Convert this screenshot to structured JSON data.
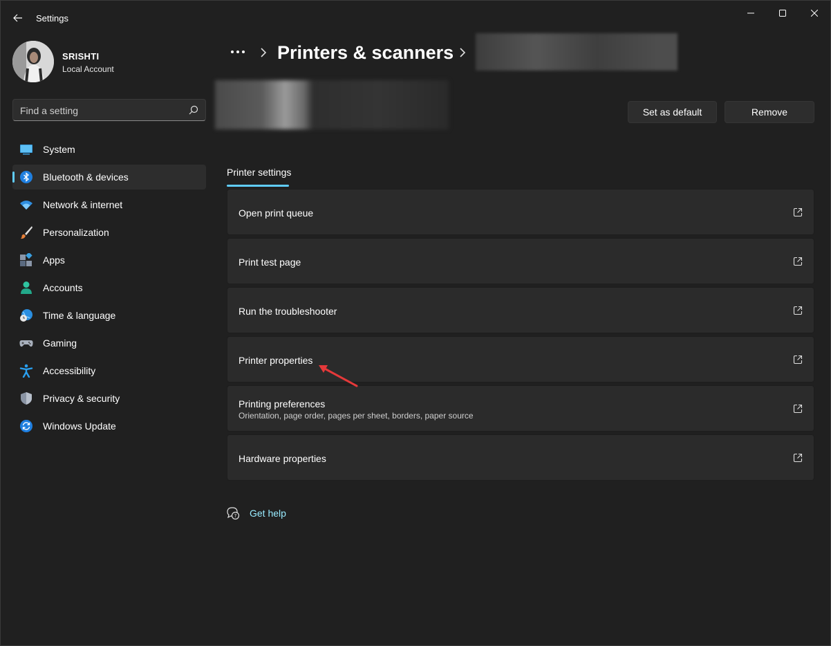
{
  "window": {
    "title": "Settings"
  },
  "profile": {
    "name": "SRISHTI",
    "account_type": "Local Account"
  },
  "search": {
    "placeholder": "Find a setting"
  },
  "nav": {
    "items": [
      {
        "label": "System",
        "icon": "monitor-icon"
      },
      {
        "label": "Bluetooth & devices",
        "icon": "bluetooth-icon",
        "selected": true
      },
      {
        "label": "Network & internet",
        "icon": "wifi-icon"
      },
      {
        "label": "Personalization",
        "icon": "brush-icon"
      },
      {
        "label": "Apps",
        "icon": "apps-icon"
      },
      {
        "label": "Accounts",
        "icon": "person-icon"
      },
      {
        "label": "Time & language",
        "icon": "globe-clock-icon"
      },
      {
        "label": "Gaming",
        "icon": "gamepad-icon"
      },
      {
        "label": "Accessibility",
        "icon": "accessibility-icon"
      },
      {
        "label": "Privacy & security",
        "icon": "shield-icon"
      },
      {
        "label": "Windows Update",
        "icon": "update-icon"
      }
    ]
  },
  "breadcrumb": {
    "more": "...",
    "title": "Printers & scanners"
  },
  "printer": {
    "set_default_label": "Set as default",
    "remove_label": "Remove"
  },
  "tabs": {
    "active": "Printer settings"
  },
  "cards": [
    {
      "title": "Open print queue"
    },
    {
      "title": "Print test page"
    },
    {
      "title": "Run the troubleshooter"
    },
    {
      "title": "Printer properties"
    },
    {
      "title": "Printing preferences",
      "subtitle": "Orientation, page order, pages per sheet, borders, paper source"
    },
    {
      "title": "Hardware properties"
    }
  ],
  "help": {
    "label": "Get help"
  },
  "colors": {
    "accent": "#60cdff",
    "background": "#202020",
    "card": "#2b2b2b",
    "link": "#99ebff",
    "annotation": "#e5393a"
  }
}
